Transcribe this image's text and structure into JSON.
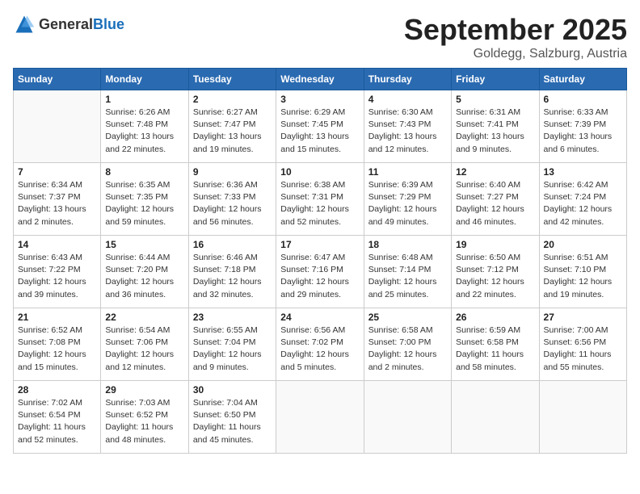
{
  "logo": {
    "general": "General",
    "blue": "Blue"
  },
  "title": "September 2025",
  "subtitle": "Goldegg, Salzburg, Austria",
  "weekdays": [
    "Sunday",
    "Monday",
    "Tuesday",
    "Wednesday",
    "Thursday",
    "Friday",
    "Saturday"
  ],
  "weeks": [
    [
      {
        "day": "",
        "info": ""
      },
      {
        "day": "1",
        "info": "Sunrise: 6:26 AM\nSunset: 7:48 PM\nDaylight: 13 hours\nand 22 minutes."
      },
      {
        "day": "2",
        "info": "Sunrise: 6:27 AM\nSunset: 7:47 PM\nDaylight: 13 hours\nand 19 minutes."
      },
      {
        "day": "3",
        "info": "Sunrise: 6:29 AM\nSunset: 7:45 PM\nDaylight: 13 hours\nand 15 minutes."
      },
      {
        "day": "4",
        "info": "Sunrise: 6:30 AM\nSunset: 7:43 PM\nDaylight: 13 hours\nand 12 minutes."
      },
      {
        "day": "5",
        "info": "Sunrise: 6:31 AM\nSunset: 7:41 PM\nDaylight: 13 hours\nand 9 minutes."
      },
      {
        "day": "6",
        "info": "Sunrise: 6:33 AM\nSunset: 7:39 PM\nDaylight: 13 hours\nand 6 minutes."
      }
    ],
    [
      {
        "day": "7",
        "info": "Sunrise: 6:34 AM\nSunset: 7:37 PM\nDaylight: 13 hours\nand 2 minutes."
      },
      {
        "day": "8",
        "info": "Sunrise: 6:35 AM\nSunset: 7:35 PM\nDaylight: 12 hours\nand 59 minutes."
      },
      {
        "day": "9",
        "info": "Sunrise: 6:36 AM\nSunset: 7:33 PM\nDaylight: 12 hours\nand 56 minutes."
      },
      {
        "day": "10",
        "info": "Sunrise: 6:38 AM\nSunset: 7:31 PM\nDaylight: 12 hours\nand 52 minutes."
      },
      {
        "day": "11",
        "info": "Sunrise: 6:39 AM\nSunset: 7:29 PM\nDaylight: 12 hours\nand 49 minutes."
      },
      {
        "day": "12",
        "info": "Sunrise: 6:40 AM\nSunset: 7:27 PM\nDaylight: 12 hours\nand 46 minutes."
      },
      {
        "day": "13",
        "info": "Sunrise: 6:42 AM\nSunset: 7:24 PM\nDaylight: 12 hours\nand 42 minutes."
      }
    ],
    [
      {
        "day": "14",
        "info": "Sunrise: 6:43 AM\nSunset: 7:22 PM\nDaylight: 12 hours\nand 39 minutes."
      },
      {
        "day": "15",
        "info": "Sunrise: 6:44 AM\nSunset: 7:20 PM\nDaylight: 12 hours\nand 36 minutes."
      },
      {
        "day": "16",
        "info": "Sunrise: 6:46 AM\nSunset: 7:18 PM\nDaylight: 12 hours\nand 32 minutes."
      },
      {
        "day": "17",
        "info": "Sunrise: 6:47 AM\nSunset: 7:16 PM\nDaylight: 12 hours\nand 29 minutes."
      },
      {
        "day": "18",
        "info": "Sunrise: 6:48 AM\nSunset: 7:14 PM\nDaylight: 12 hours\nand 25 minutes."
      },
      {
        "day": "19",
        "info": "Sunrise: 6:50 AM\nSunset: 7:12 PM\nDaylight: 12 hours\nand 22 minutes."
      },
      {
        "day": "20",
        "info": "Sunrise: 6:51 AM\nSunset: 7:10 PM\nDaylight: 12 hours\nand 19 minutes."
      }
    ],
    [
      {
        "day": "21",
        "info": "Sunrise: 6:52 AM\nSunset: 7:08 PM\nDaylight: 12 hours\nand 15 minutes."
      },
      {
        "day": "22",
        "info": "Sunrise: 6:54 AM\nSunset: 7:06 PM\nDaylight: 12 hours\nand 12 minutes."
      },
      {
        "day": "23",
        "info": "Sunrise: 6:55 AM\nSunset: 7:04 PM\nDaylight: 12 hours\nand 9 minutes."
      },
      {
        "day": "24",
        "info": "Sunrise: 6:56 AM\nSunset: 7:02 PM\nDaylight: 12 hours\nand 5 minutes."
      },
      {
        "day": "25",
        "info": "Sunrise: 6:58 AM\nSunset: 7:00 PM\nDaylight: 12 hours\nand 2 minutes."
      },
      {
        "day": "26",
        "info": "Sunrise: 6:59 AM\nSunset: 6:58 PM\nDaylight: 11 hours\nand 58 minutes."
      },
      {
        "day": "27",
        "info": "Sunrise: 7:00 AM\nSunset: 6:56 PM\nDaylight: 11 hours\nand 55 minutes."
      }
    ],
    [
      {
        "day": "28",
        "info": "Sunrise: 7:02 AM\nSunset: 6:54 PM\nDaylight: 11 hours\nand 52 minutes."
      },
      {
        "day": "29",
        "info": "Sunrise: 7:03 AM\nSunset: 6:52 PM\nDaylight: 11 hours\nand 48 minutes."
      },
      {
        "day": "30",
        "info": "Sunrise: 7:04 AM\nSunset: 6:50 PM\nDaylight: 11 hours\nand 45 minutes."
      },
      {
        "day": "",
        "info": ""
      },
      {
        "day": "",
        "info": ""
      },
      {
        "day": "",
        "info": ""
      },
      {
        "day": "",
        "info": ""
      }
    ]
  ]
}
